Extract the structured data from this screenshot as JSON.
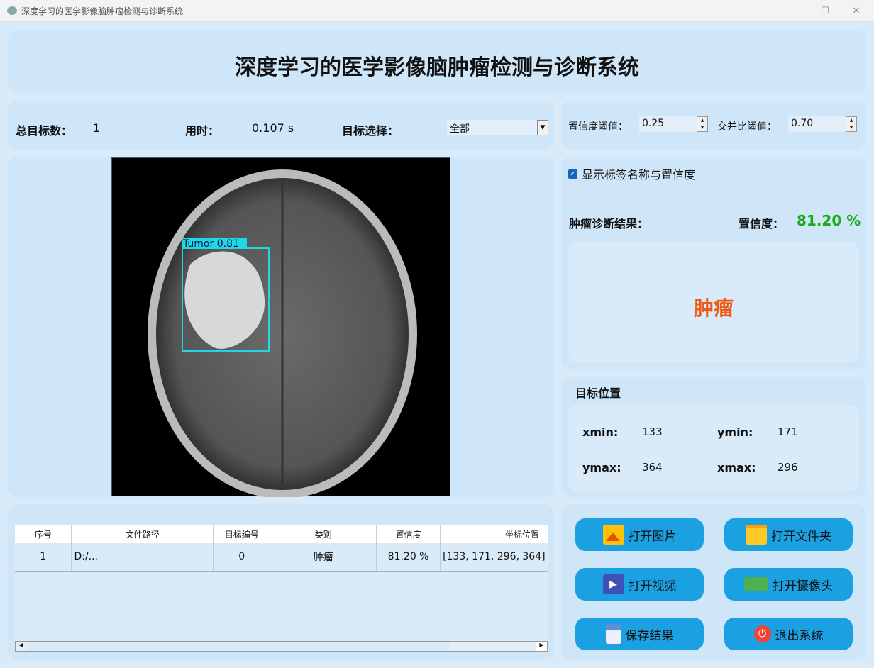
{
  "window": {
    "title": "深度学习的医学影像脑肿瘤检测与诊断系统",
    "minimize": "—",
    "maximize": "☐",
    "close": "✕"
  },
  "header": {
    "title": "深度学习的医学影像脑肿瘤检测与诊断系统"
  },
  "stats": {
    "total_label": "总目标数：",
    "total_value": "1",
    "time_label": "用时：",
    "time_value": "0.107 s",
    "select_label": "目标选择：",
    "select_value": "全部"
  },
  "thresholds": {
    "conf_label": "置信度阈值：",
    "conf_value": "0.25",
    "iou_label": "交并比阈值：",
    "iou_value": "0.70"
  },
  "image": {
    "detection_label": "Tumor  0.81",
    "box_color": "#1ed8e6"
  },
  "options": {
    "show_labels": "显示标签名称与置信度",
    "show_labels_checked": true
  },
  "diagnosis": {
    "label": "肿瘤诊断结果：",
    "conf_label": "置信度：",
    "conf_value": "81.20 %",
    "result": "肿瘤",
    "result_color": "#f05a14",
    "conf_color": "#1aaa1a"
  },
  "position": {
    "title": "目标位置",
    "xmin_label": "xmin:",
    "xmin": "133",
    "ymin_label": "ymin:",
    "ymin": "171",
    "ymax_label": "ymax:",
    "ymax": "364",
    "xmax_label": "xmax:",
    "xmax": "296"
  },
  "table": {
    "headers": [
      "序号",
      "文件路径",
      "目标编号",
      "类别",
      "置信度",
      "坐标位置"
    ],
    "rows": [
      [
        "1",
        "D:/...",
        "0",
        "肿瘤",
        "81.20 %",
        "[133, 171, 296, 364]"
      ]
    ]
  },
  "buttons": {
    "open_image": "打开图片",
    "open_folder": "打开文件夹",
    "open_video": "打开视频",
    "open_camera": "打开摄像头",
    "save": "保存结果",
    "exit": "退出系统"
  }
}
